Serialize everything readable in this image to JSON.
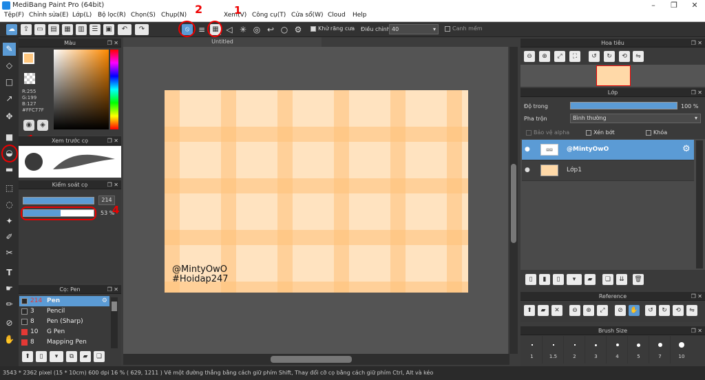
{
  "window": {
    "title": "MediBang Paint Pro (64bit)"
  },
  "menu": [
    "Tệp(F)",
    "Chỉnh sửa(E)",
    "Lớp(L)",
    "Bộ lọc(R)",
    "Chọn(S)",
    "Chụp(N)",
    "Xem(V)",
    "Công cụ(T)",
    "Cửa sổ(W)",
    "Cloud",
    "Help"
  ],
  "toolbar": {
    "antialias_label": "Khử răng cưa",
    "adjust_label": "Điều chỉnh",
    "adjust_value": "40",
    "smooth_label": "Canh mềm"
  },
  "annotations": {
    "n1": "1",
    "n2": "2",
    "n3": "3",
    "n4": "4"
  },
  "color_panel": {
    "title": "Màu",
    "r": "R:255",
    "g": "G:199",
    "b": "B:127",
    "hex": "#FFC77F"
  },
  "brush_preview": {
    "title": "Xem trước cọ"
  },
  "brush_control": {
    "title": "Kiểm soát cọ",
    "size": "214",
    "opacity": "53 %",
    "size_fill": 1.0,
    "opacity_fill": 0.53
  },
  "brush_list": {
    "title": "Cọ: Pen",
    "items": [
      {
        "size": "214",
        "name": "Pen",
        "color": "#2a2a2a",
        "selected": true
      },
      {
        "size": "3",
        "name": "Pencil",
        "color": "#2a2a2a",
        "selected": false
      },
      {
        "size": "8",
        "name": "Pen (Sharp)",
        "color": "#2a2a2a",
        "selected": false
      },
      {
        "size": "10",
        "name": "G Pen",
        "color": "#e53935",
        "selected": false
      },
      {
        "size": "8",
        "name": "Mapping Pen",
        "color": "#e53935",
        "selected": false
      }
    ]
  },
  "canvas": {
    "tab": "Untitled",
    "line1": "@MintyOwO",
    "line2": "#Hoidap247"
  },
  "navigator": {
    "title": "Hoa tiêu"
  },
  "layer_panel": {
    "title": "Lớp",
    "opacity_label": "Độ trong",
    "opacity_value": "100 %",
    "opacity_fill": 1.0,
    "blend_label": "Pha trộn",
    "blend_value": "Bình thường",
    "protect_alpha": "Bảo vệ alpha",
    "clipping": "Xén bớt",
    "lock": "Khóa",
    "layers": [
      {
        "name": "@MintyOwO",
        "selected": true
      },
      {
        "name": "Lớp1",
        "selected": false
      }
    ]
  },
  "reference": {
    "title": "Reference"
  },
  "brush_size": {
    "title": "Brush Size",
    "sizes": [
      "1",
      "1.5",
      "2",
      "3",
      "4",
      "5",
      "7",
      "10"
    ]
  },
  "status": {
    "text": "3543 * 2362 pixel  (15 * 10cm)  600 dpi  16 %  ( 629, 1211 )  Vẽ một đường thẳng bằng cách giữ phím Shift, Thay đổi cỡ cọ bằng cách giữ phím Ctrl, Alt và kéo"
  },
  "colors": {
    "accent": "#5b9bd5",
    "annotation": "#e00000",
    "fg_color": "#FFC77F"
  }
}
